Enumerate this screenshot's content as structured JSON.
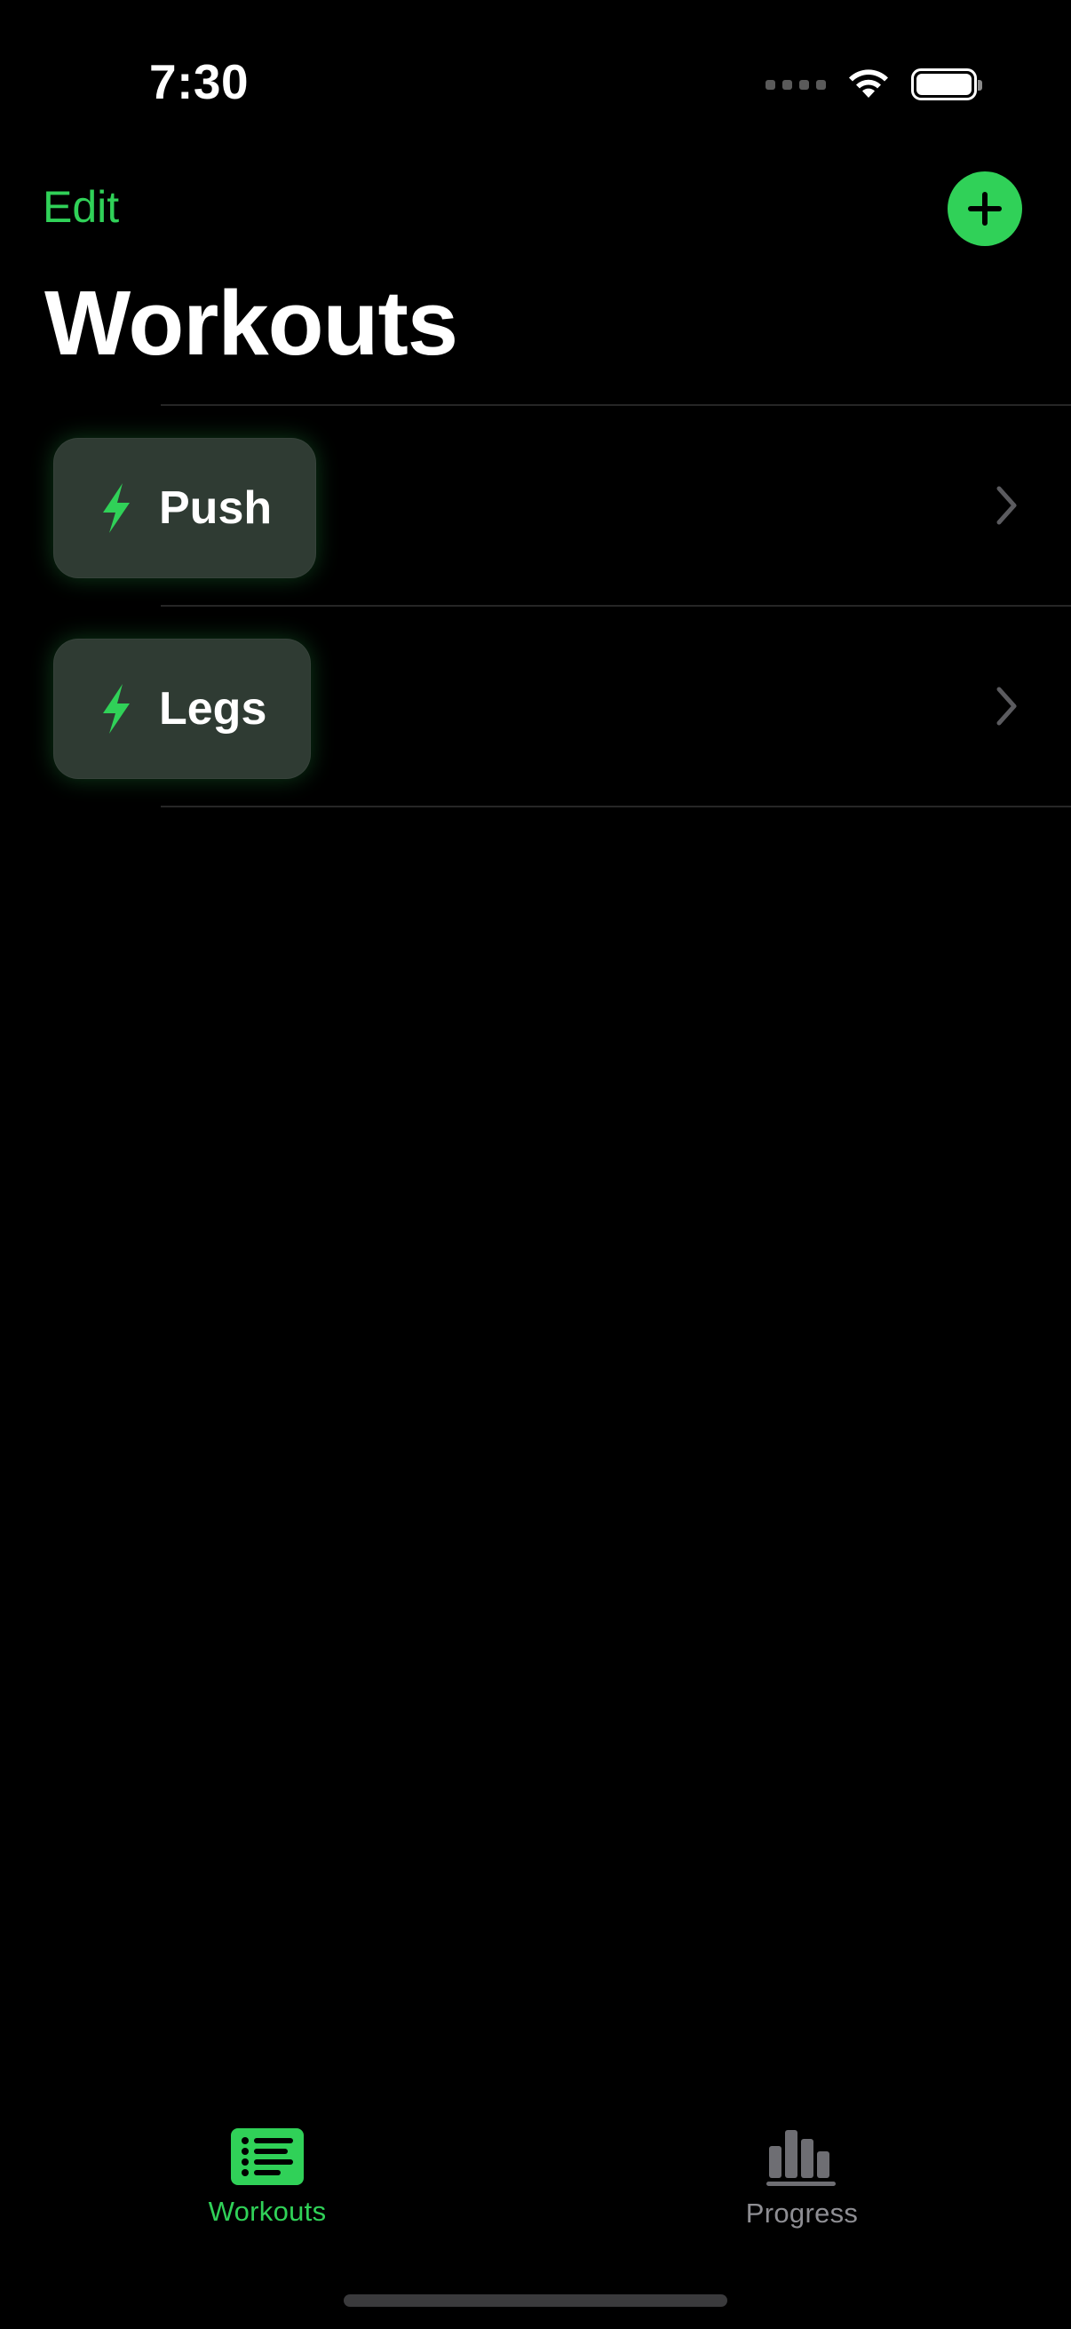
{
  "status_bar": {
    "time": "7:30"
  },
  "nav": {
    "edit_label": "Edit",
    "add_icon": "plus-icon"
  },
  "page": {
    "title": "Workouts"
  },
  "workouts": [
    {
      "name": "Push",
      "icon": "bolt-icon"
    },
    {
      "name": "Legs",
      "icon": "bolt-icon"
    }
  ],
  "tab_bar": {
    "tabs": [
      {
        "label": "Workouts",
        "icon": "list-icon",
        "selected": true
      },
      {
        "label": "Progress",
        "icon": "bar-chart-icon",
        "selected": false
      }
    ]
  },
  "colors": {
    "accent": "#30d158",
    "background": "#000000",
    "chip_background": "#2f3b33",
    "inactive_tab": "#8e8e93"
  }
}
